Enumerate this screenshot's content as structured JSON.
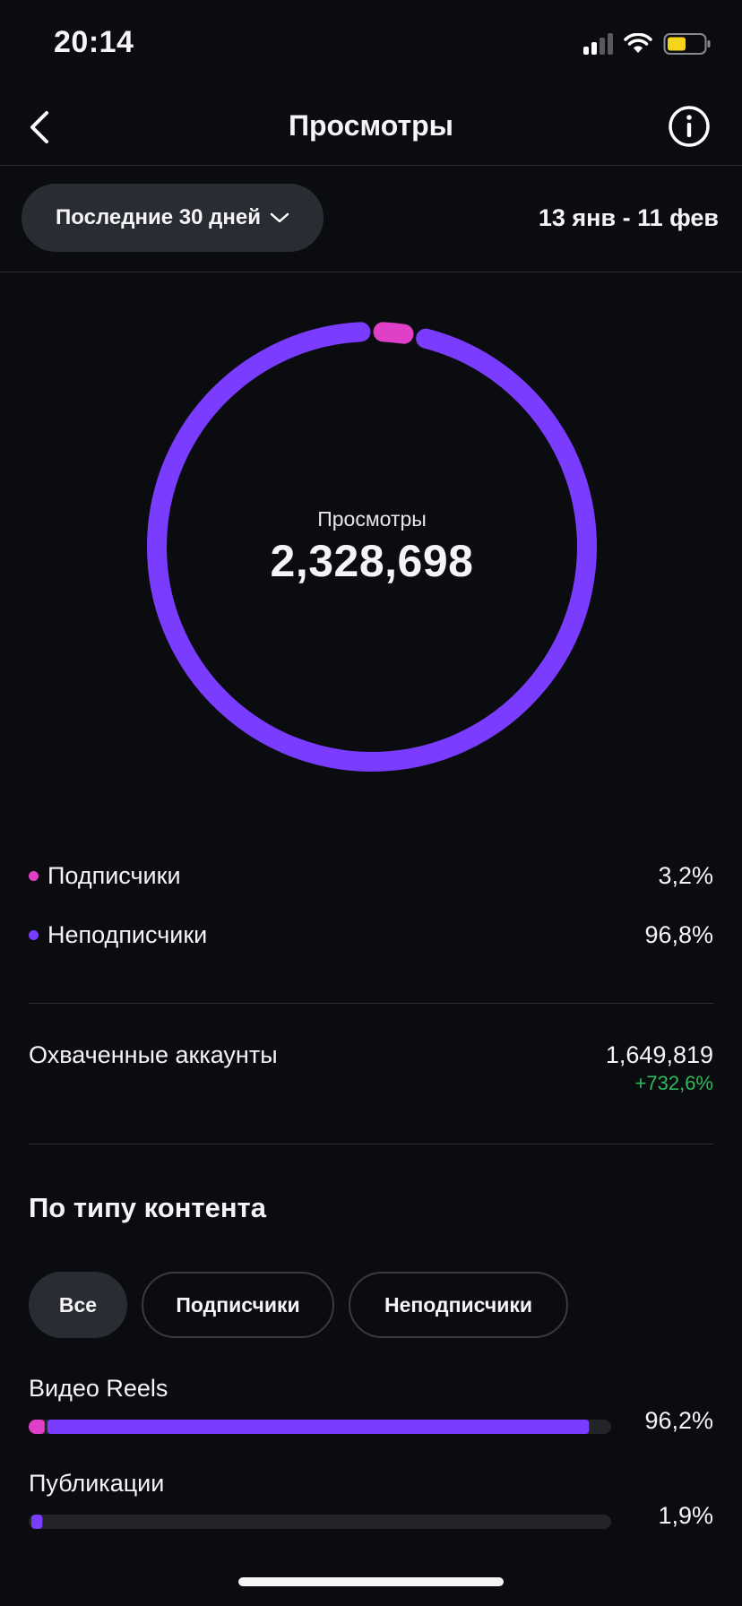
{
  "status": {
    "time": "20:14"
  },
  "header": {
    "title": "Просмотры"
  },
  "filters": {
    "period": "Последние 30 дней",
    "date_range": "13 янв - 11 фев"
  },
  "summary": {
    "label": "Просмотры",
    "total": "2,328,698"
  },
  "colors": {
    "followers": "#e040c8",
    "non_followers": "#7a3cff",
    "positive": "#2fb85c"
  },
  "breakdown": [
    {
      "label": "Подписчики",
      "value": "3,2%",
      "fraction": 0.032
    },
    {
      "label": "Неподписчики",
      "value": "96,8%",
      "fraction": 0.968
    }
  ],
  "reached": {
    "label": "Охваченные аккаунты",
    "value": "1,649,819",
    "change": "+732,6%"
  },
  "content_type": {
    "title": "По типу контента",
    "chips": [
      "Все",
      "Подписчики",
      "Неподписчики"
    ],
    "active_chip": "Все",
    "items": [
      {
        "label": "Видео Reels",
        "value": "96,2%",
        "followers_fraction": 0.032,
        "total_fraction": 0.962
      },
      {
        "label": "Публикации",
        "value": "1,9%",
        "followers_fraction": 0.0,
        "total_fraction": 0.019
      }
    ]
  }
}
